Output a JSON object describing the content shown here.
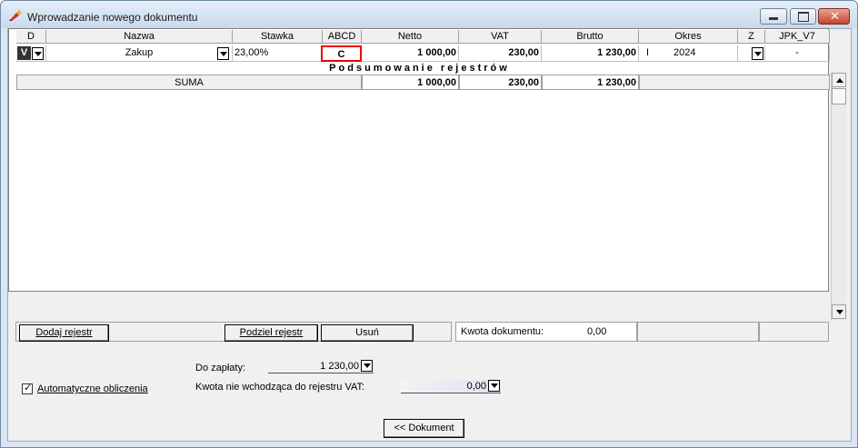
{
  "window": {
    "title": "Wprowadzanie nowego dokumentu"
  },
  "table": {
    "headers": [
      "D",
      "Nazwa",
      "Stawka",
      "ABCD",
      "Netto",
      "VAT",
      "Brutto",
      "Okres",
      "Z",
      "JPK_V7"
    ],
    "row": {
      "d": "V",
      "nazwa": "Zakup",
      "stawka": "23,00%",
      "abcd": "C",
      "netto": "1 000,00",
      "vat": "230,00",
      "brutto": "1 230,00",
      "okres_month": "I",
      "okres_year": "2024",
      "jpk": "-"
    },
    "section_title": "Podsumowanie rejestrów",
    "sum": {
      "label": "SUMA",
      "netto": "1 000,00",
      "vat": "230,00",
      "brutto": "1 230,00"
    }
  },
  "footer": {
    "add_label": "Dodaj rejestr",
    "split_label": "Podziel rejestr",
    "delete_label": "Usuń",
    "amount_label": "Kwota dokumentu:",
    "amount_value": "0,00"
  },
  "bottom": {
    "do_zaplaty_label": "Do zapłaty:",
    "do_zaplaty_value": "1 230,00",
    "auto_label": "Automatyczne obliczenia",
    "kwota_nie_label": "Kwota nie wchodząca do rejestru VAT:",
    "kwota_nie_value": "0,00",
    "dokument_button": "<< Dokument"
  },
  "colors": {
    "highlight": "#e00000",
    "titlebar": "#c9d9ec"
  },
  "icons": {
    "app": "pen-icon",
    "min": "minimize-icon",
    "max": "maximize-icon",
    "close": "close-icon"
  }
}
